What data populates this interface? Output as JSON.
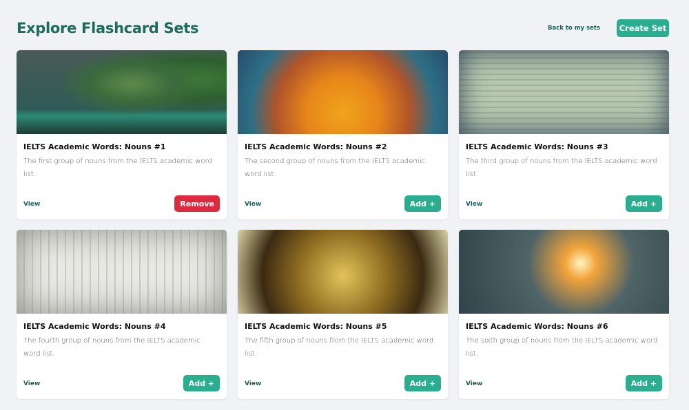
{
  "header": {
    "title": "Explore Flashcard Sets",
    "back_link": "Back to my sets",
    "create_button": "Create Set"
  },
  "cards": [
    {
      "title": "IELTS Academic Words: Nouns #1",
      "description": "The first group of nouns from the IELTS academic word list.",
      "view": "View",
      "action": "Remove"
    },
    {
      "title": "IELTS Academic Words: Nouns #2",
      "description": "The second group of nouns from the IELTS academic word list.",
      "view": "View",
      "action": "Add +"
    },
    {
      "title": "IELTS Academic Words: Nouns #3",
      "description": "The third group of nouns from the IELTS academic word list.",
      "view": "View",
      "action": "Add +"
    },
    {
      "title": "IELTS Academic Words: Nouns #4",
      "description": "The fourth group of nouns from the IELTS academic word list.",
      "view": "View",
      "action": "Add +"
    },
    {
      "title": "IELTS Academic Words: Nouns #5",
      "description": "The fifth group of nouns from the IELTS academic word list.",
      "view": "View",
      "action": "Add +"
    },
    {
      "title": "IELTS Academic Words: Nouns #6",
      "description": "The sixth group of nouns from the IELTS academic word list.",
      "view": "View",
      "action": "Add +"
    }
  ],
  "colors": {
    "accent": "#2bae8f",
    "danger": "#dc2a41",
    "heading": "#1d6b5a"
  }
}
